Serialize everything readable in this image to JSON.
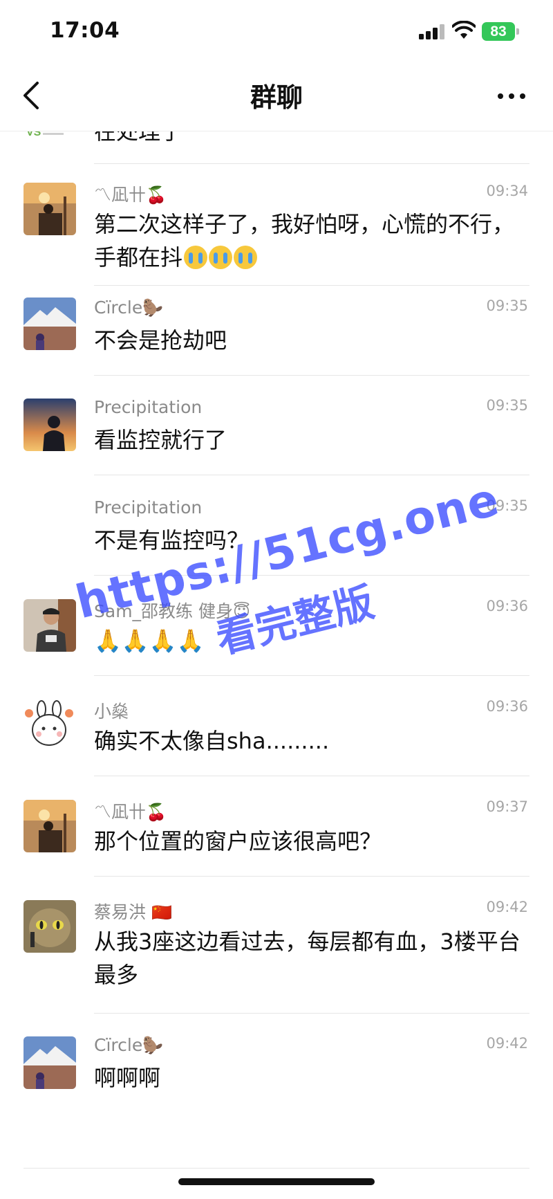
{
  "status_bar": {
    "time": "17:04",
    "battery": "83"
  },
  "nav": {
    "title": "群聊"
  },
  "colors": {
    "battery": "#34c759",
    "watermark": "#3b4cff",
    "divider": "#e6e6e6"
  },
  "messages": [
    {
      "sender": "",
      "time": "",
      "text": "在处理了",
      "avatar_icon": "vs-logo-avatar"
    },
    {
      "sender": "〽凪卄",
      "deco": "🍒",
      "time": "09:34",
      "text": "第二次这样子了，我好怕呀，心慌的不行，手都在抖",
      "emoji": "crying-face-icon ×3",
      "avatar_icon": "person-photo-avatar"
    },
    {
      "sender": "Cïrcle",
      "deco": "🦫",
      "time": "09:35",
      "text": "不会是抢劫吧",
      "avatar_icon": "mountain-photo-avatar"
    },
    {
      "sender": "Precipitation",
      "time": "09:35",
      "text": "看监控就行了",
      "avatar_icon": "sunset-silhouette-avatar"
    },
    {
      "sender": "Precipitation",
      "time": "09:35",
      "text": "不是有监控吗？"
    },
    {
      "sender": "Sam_邵教练 健身",
      "deco": "😇",
      "time": "09:36",
      "text": "🙏🙏🙏🙏",
      "avatar_icon": "man-photo-avatar"
    },
    {
      "sender": "小燊",
      "time": "09:36",
      "text": "确实不太像自sha.........",
      "avatar_icon": "bunny-cartoon-avatar"
    },
    {
      "sender": "〽凪卄",
      "deco": "🍒",
      "time": "09:37",
      "text": "那个位置的窗户应该很高吧？",
      "avatar_icon": "person-photo-avatar"
    },
    {
      "sender": "蔡易洪",
      "deco": "🇨🇳",
      "time": "09:42",
      "text": "从我3座这边看过去，每层都有血，3楼平台最多",
      "avatar_icon": "cat-photo-avatar"
    },
    {
      "sender": "Cïrcle",
      "deco": "🦫",
      "time": "09:42",
      "text": "啊啊啊",
      "avatar_icon": "mountain-photo-avatar"
    }
  ],
  "watermark": {
    "url": "https://51cg.one",
    "sub": "看完整版"
  }
}
